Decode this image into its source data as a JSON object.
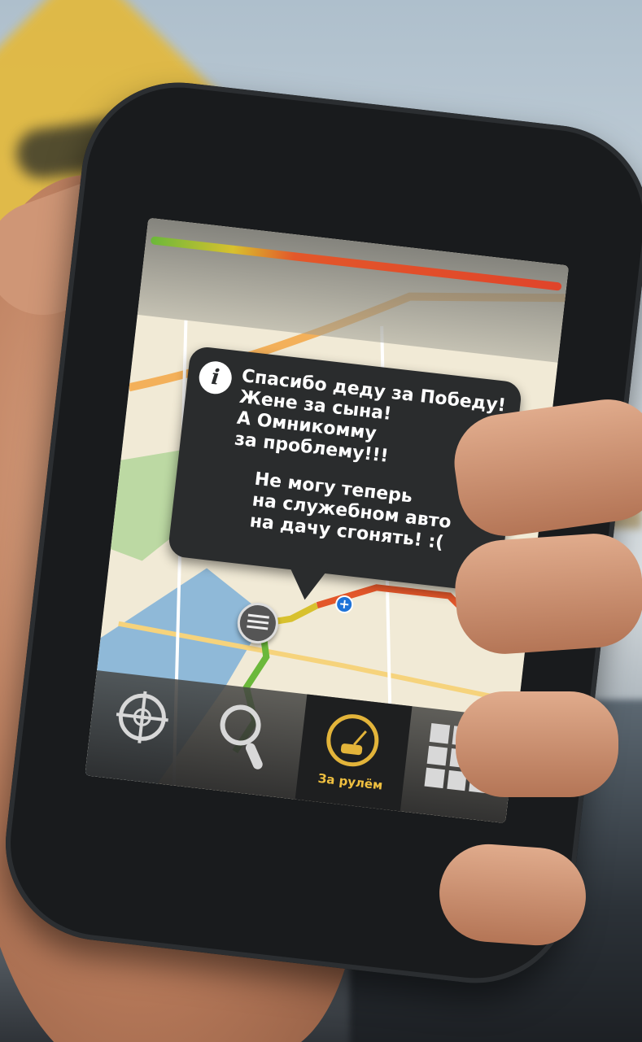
{
  "bubble": {
    "lines": [
      "Спасибо деду за Победу!",
      "Жене за сына!",
      "А Омникомму",
      "за проблему!!!",
      "Не могу теперь",
      "на служебном авто",
      "на дачу сгонять! :("
    ],
    "info_icon_glyph": "i"
  },
  "toolbar": {
    "items": [
      {
        "icon": "locate-icon",
        "label": ""
      },
      {
        "icon": "search-icon",
        "label": ""
      },
      {
        "icon": "speedometer-icon",
        "label": "За рулём",
        "active": true
      },
      {
        "icon": "grid-menu-icon",
        "label": ""
      }
    ]
  },
  "map": {
    "plus_glyph": "+",
    "route_colors": [
      "#6bb83a",
      "#d8c12e",
      "#e3572a",
      "#e0442a"
    ]
  }
}
